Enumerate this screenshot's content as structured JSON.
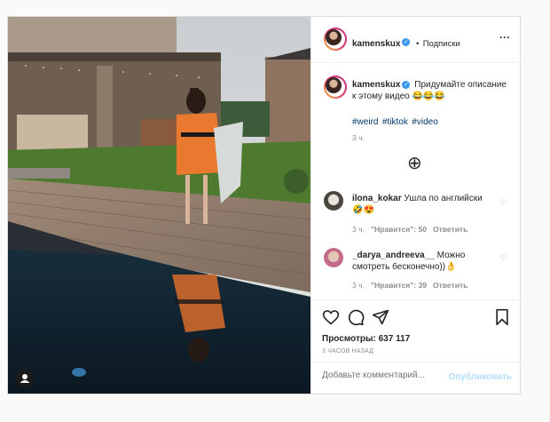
{
  "header": {
    "username": "kamenskux",
    "dot": "•",
    "follow": "Подписки",
    "more": "···"
  },
  "caption": {
    "username": "kamenskux",
    "text": "Придумайте описание к этому видео 😂😂😂",
    "hashtags": [
      "#weird",
      "#tiktok",
      "#video"
    ],
    "time": "3 ч."
  },
  "load_more": "⊕",
  "comments": [
    {
      "username": "ilona_kokar",
      "text": "Ушла по английски 🤣😍",
      "time": "3 ч.",
      "likes": "\"Нравится\": 50",
      "reply": "Ответить"
    },
    {
      "username": "_darya_andreeva__",
      "text": "Можно смотреть бесконечно))👌",
      "time": "3 ч.",
      "likes": "\"Нравится\": 39",
      "reply": "Ответить"
    }
  ],
  "stats": {
    "views": "Просмотры: 637 117",
    "posted": "3 ЧАСОВ НАЗАД"
  },
  "add_comment": {
    "placeholder": "Добавьте комментарий...",
    "publish": "Опубликовать"
  },
  "icons": {
    "heart": "heart-icon",
    "comment": "comment-icon",
    "share": "share-icon",
    "bookmark": "bookmark-icon",
    "user_tag": "user-tag-icon"
  },
  "colors": {
    "link": "#00376b",
    "publish_disabled": "#b2dffc",
    "verified": "#3897f0"
  }
}
